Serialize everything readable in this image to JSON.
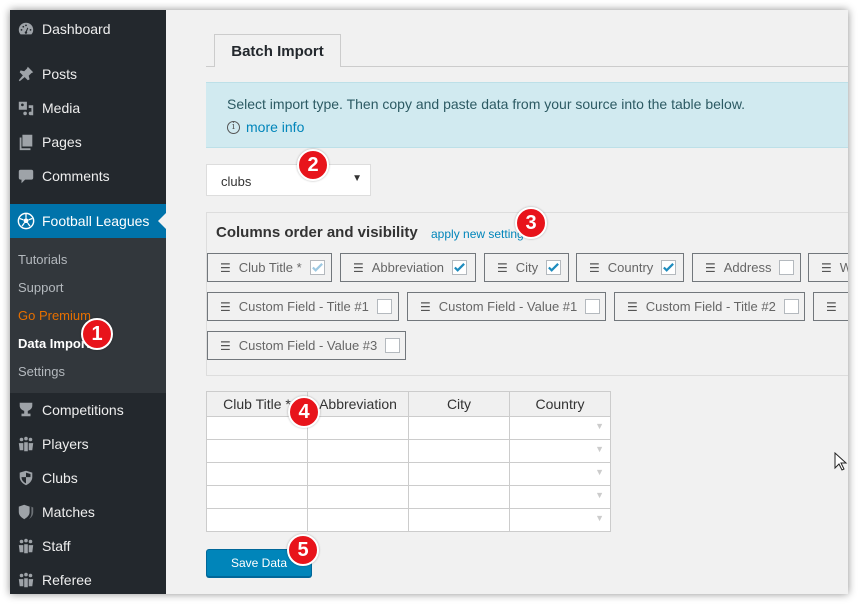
{
  "sidebar": {
    "top_items": [
      {
        "label": "Dashboard",
        "icon": "dashboard-icon"
      },
      {
        "label": "Posts",
        "icon": "pin-icon"
      },
      {
        "label": "Media",
        "icon": "media-icon"
      },
      {
        "label": "Pages",
        "icon": "pages-icon"
      },
      {
        "label": "Comments",
        "icon": "comment-icon"
      }
    ],
    "active_item": {
      "label": "Football Leagues",
      "icon": "soccer-ball-icon"
    },
    "submenu": [
      {
        "label": "Tutorials",
        "state": "normal"
      },
      {
        "label": "Support",
        "state": "normal"
      },
      {
        "label": "Go Premium",
        "state": "premium"
      },
      {
        "label": "Data Import",
        "state": "current"
      },
      {
        "label": "Settings",
        "state": "normal"
      }
    ],
    "bottom_items": [
      {
        "label": "Competitions",
        "icon": "trophy-icon"
      },
      {
        "label": "Players",
        "icon": "groups-icon"
      },
      {
        "label": "Clubs",
        "icon": "shield-icon"
      },
      {
        "label": "Matches",
        "icon": "shields-icon"
      },
      {
        "label": "Staff",
        "icon": "groups-icon"
      },
      {
        "label": "Referee",
        "icon": "groups-icon"
      }
    ]
  },
  "main": {
    "tab_label": "Batch Import",
    "notice_text": "Select import type. Then copy and paste data from your source into the table below.",
    "notice_link": "more info",
    "import_type": {
      "selected": "clubs"
    },
    "columns": {
      "title": "Columns order and visibility",
      "apply_link": "apply new settings",
      "chips": [
        {
          "label": "Club Title *",
          "checked": true,
          "disabled": true
        },
        {
          "label": "Abbreviation",
          "checked": true,
          "disabled": false
        },
        {
          "label": "City",
          "checked": true,
          "disabled": false
        },
        {
          "label": "Country",
          "checked": true,
          "disabled": false
        },
        {
          "label": "Address",
          "checked": false,
          "disabled": false
        },
        {
          "label": "W",
          "checked": false,
          "disabled": false
        },
        {
          "label": "Custom Field - Title #1",
          "checked": false,
          "disabled": false
        },
        {
          "label": "Custom Field - Value #1",
          "checked": false,
          "disabled": false
        },
        {
          "label": "Custom Field - Title #2",
          "checked": false,
          "disabled": false
        },
        {
          "label": "",
          "checked": false,
          "disabled": false
        },
        {
          "label": "Custom Field - Value #3",
          "checked": false,
          "disabled": false
        }
      ]
    },
    "table": {
      "headers": [
        "Club Title *",
        "Abbreviation",
        "City",
        "Country"
      ],
      "rows": [
        [
          "",
          "",
          "",
          ""
        ],
        [
          "",
          "",
          "",
          ""
        ],
        [
          "",
          "",
          "",
          ""
        ],
        [
          "",
          "",
          "",
          ""
        ],
        [
          "",
          "",
          "",
          ""
        ]
      ]
    },
    "save_button": "Save Data"
  },
  "markers": [
    "1",
    "2",
    "3",
    "4",
    "5"
  ],
  "colors": {
    "sidebar_bg": "#23282d",
    "submenu_bg": "#32373c",
    "active_blue": "#0073aa",
    "button_blue": "#0085ba",
    "premium_orange": "#e66f00",
    "notice_bg": "#d1eaf0",
    "marker_red": "#e8141b"
  }
}
